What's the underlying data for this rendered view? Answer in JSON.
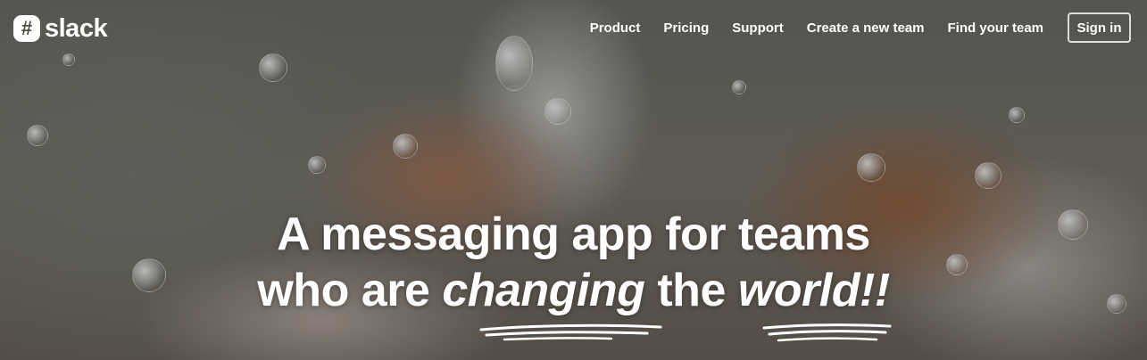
{
  "brand": {
    "name": "slack",
    "icon_glyph": "#"
  },
  "nav": {
    "links": [
      {
        "label": "Product"
      },
      {
        "label": "Pricing"
      },
      {
        "label": "Support"
      },
      {
        "label": "Create a new team"
      },
      {
        "label": "Find your team"
      }
    ],
    "signin_label": "Sign in"
  },
  "hero": {
    "line1": "A messaging app for teams",
    "line2_prefix": "who are ",
    "line2_em1": "changing",
    "line2_mid": " the ",
    "line2_em2": "world",
    "line2_suffix": "!!"
  },
  "colors": {
    "text": "#ffffff",
    "logo_icon_bg": "#ffffff"
  }
}
